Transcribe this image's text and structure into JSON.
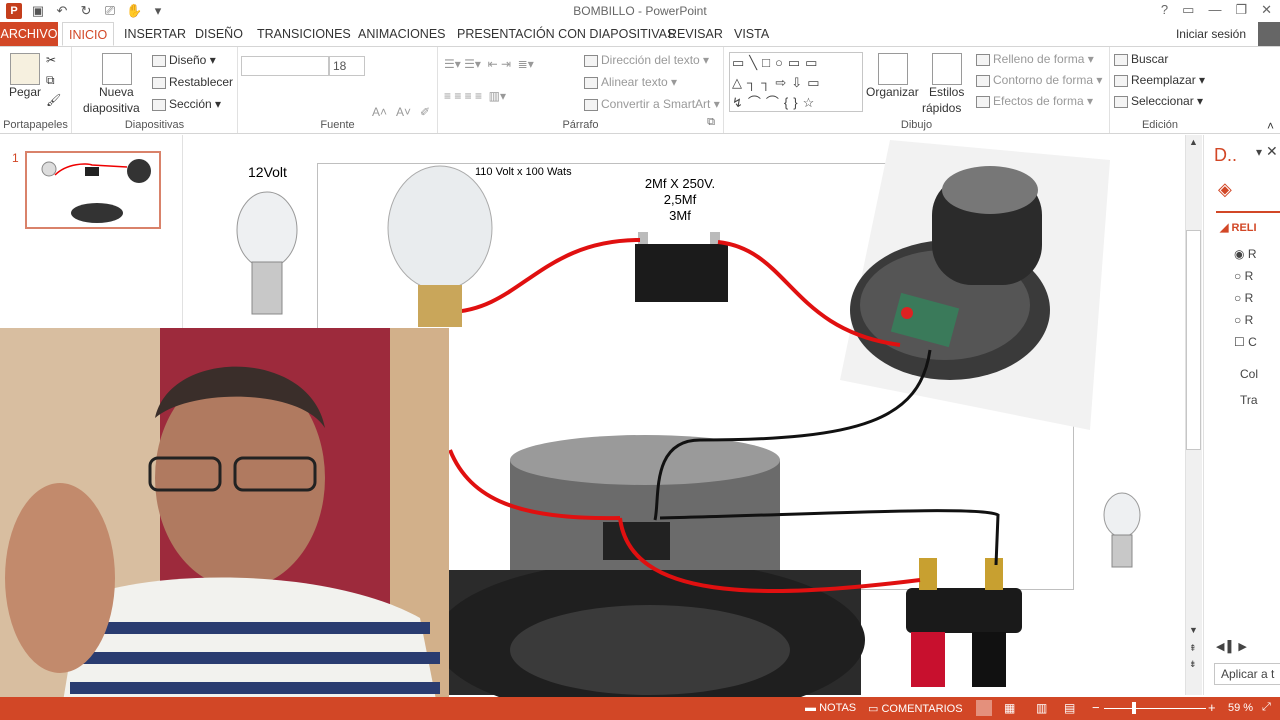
{
  "window": {
    "title": "BOMBILLO - PowerPoint",
    "help": "?",
    "controls": [
      "▭",
      "—",
      "❐",
      "✕"
    ]
  },
  "tabs": [
    "ARCHIVO",
    "INICIO",
    "INSERTAR",
    "DISEÑO",
    "TRANSICIONES",
    "ANIMACIONES",
    "PRESENTACIÓN CON DIAPOSITIVAS",
    "REVISAR",
    "VISTA"
  ],
  "signin": "Iniciar sesión",
  "ribbon": {
    "clipboard": {
      "paste": "Pegar",
      "label": "Portapapeles"
    },
    "slides": {
      "new_slide_1": "Nueva",
      "new_slide_2": "diapositiva",
      "layout": "Diseño",
      "reset": "Restablecer",
      "section": "Sección",
      "label": "Diapositivas"
    },
    "font": {
      "size": "18",
      "bold": "N",
      "italic": "K",
      "underline": "S",
      "strike": "S",
      "shadow": "abc",
      "spacing": "AV",
      "case": "Aa",
      "color": "A",
      "label": "Fuente"
    },
    "paragraph": {
      "text_direction": "Dirección del texto",
      "align_text": "Alinear texto",
      "smartart": "Convertir a SmartArt",
      "label": "Párrafo"
    },
    "drawing": {
      "arrange": "Organizar",
      "quick_styles_1": "Estilos",
      "quick_styles_2": "rápidos",
      "fill": "Relleno de forma",
      "outline": "Contorno de forma",
      "effects": "Efectos de forma",
      "label": "Dibujo"
    },
    "editing": {
      "find": "Buscar",
      "replace": "Reemplazar",
      "select": "Seleccionar",
      "label": "Edición"
    }
  },
  "slide": {
    "number": "1",
    "text_12volt": "12Volt",
    "text_bulb": "110 Volt x 100 Wats",
    "text_cap_1": "2Mf X 250V.",
    "text_cap_2": "2,5Mf",
    "text_cap_3": "3Mf"
  },
  "taskpane": {
    "title": "D..",
    "section": "RELI",
    "radios": [
      "R",
      "R",
      "R",
      "R"
    ],
    "checkbox": "C",
    "color": "Col",
    "transparency": "Tra",
    "apply": "Aplicar a t"
  },
  "status": {
    "notes": "NOTAS",
    "comments": "COMENTARIOS",
    "zoom": "59 %"
  }
}
